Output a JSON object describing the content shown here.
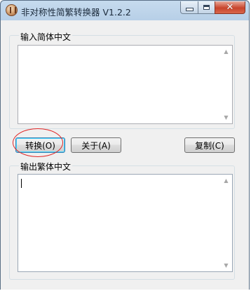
{
  "window": {
    "title": "非对称性简繁转换器 V1.2.2",
    "icon": "app-icon",
    "controls": [
      "minimize-icon",
      "maximize-icon",
      "close-icon"
    ]
  },
  "input_group": {
    "label": "输入简体中文",
    "value": ""
  },
  "buttons": {
    "convert": "转换(O)",
    "about": "关于(A)",
    "copy": "复制(C)"
  },
  "output_group": {
    "label": "输出繁体中文",
    "value": ""
  },
  "colors": {
    "annotation": "#e02626",
    "focus_border": "#3c7fb1"
  }
}
